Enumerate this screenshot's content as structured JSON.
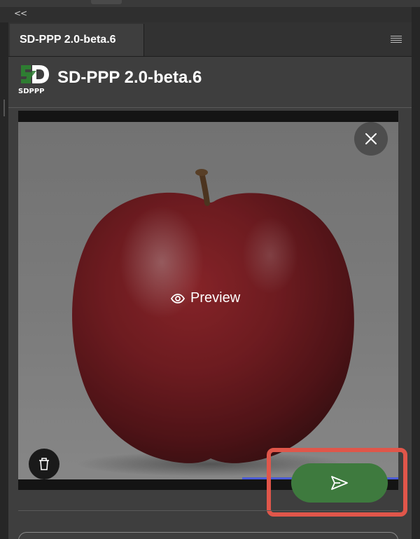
{
  "topbar": {
    "collapse_label": "<<"
  },
  "panel": {
    "tab_label": "SD-PPP 2.0-beta.6",
    "menu_icon": "hamburger-menu-icon"
  },
  "header": {
    "logo_text": "SDPPP",
    "title": "SD-PPP 2.0-beta.6"
  },
  "image_card": {
    "preview_label": "Preview",
    "icons": {
      "close": "close-icon",
      "preview": "eye-icon",
      "delete": "trash-icon",
      "send": "send-icon"
    }
  },
  "colors": {
    "panel_bg": "#3e3e3e",
    "send_button": "#3e7a3e",
    "highlight": "#e0564a",
    "progress": "#4b5bd6",
    "logo_green": "#2e7d32"
  }
}
